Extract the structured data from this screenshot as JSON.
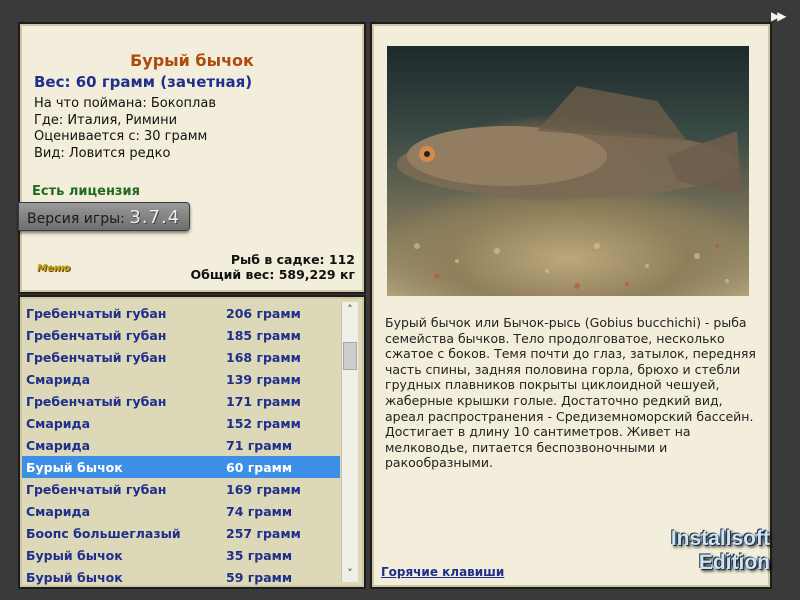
{
  "fish": {
    "title": "Бурый бычок",
    "weight": "Вес: 60 грамм (зачетная)",
    "bait": "На что поймана: Бокоплав",
    "place": "Где: Италия, Римини",
    "rated_from": "Оценивается с: 30 грамм",
    "kind": "Вид: Ловится редко"
  },
  "license": "Есть лицензия",
  "version": {
    "label": "Версия игры:",
    "number": "3.7.4"
  },
  "menu_logo": "Меню",
  "stats": {
    "fish_in_keepnet": "Рыб в садке: 112",
    "total_weight": "Общий вес: 589,229 кг"
  },
  "catch_list": [
    {
      "name": "Гребенчатый губан",
      "weight": "206 грамм"
    },
    {
      "name": "Гребенчатый губан",
      "weight": "185 грамм"
    },
    {
      "name": "Гребенчатый губан",
      "weight": "168 грамм"
    },
    {
      "name": "Смарида",
      "weight": "139 грамм"
    },
    {
      "name": "Гребенчатый губан",
      "weight": "171 грамм"
    },
    {
      "name": "Смарида",
      "weight": "152 грамм"
    },
    {
      "name": "Смарида",
      "weight": "71 грамм"
    },
    {
      "name": "Бурый бычок",
      "weight": "60 грамм"
    },
    {
      "name": "Гребенчатый губан",
      "weight": "169 грамм"
    },
    {
      "name": "Смарида",
      "weight": "74 грамм"
    },
    {
      "name": "Боопс большеглазый",
      "weight": "257 грамм"
    },
    {
      "name": "Бурый бычок",
      "weight": "35 грамм"
    },
    {
      "name": "Бурый бычок",
      "weight": "59 грамм"
    }
  ],
  "selected_index": 7,
  "description": "Бурый бычок или Бычок-рысь (Gobius bucchichi) - рыба семейства бычков. Тело продолговатое, несколько сжатое с боков. Темя почти до глаз, затылок, передняя часть спины, задняя половина горла, брюхо и стебли грудных плавников покрыты циклоидной чешуей, жаберные крышки голые. Достаточно редкий вид, ареал распространения - Средиземноморский бассейн. Достигает в длину 10 сантиметров. Живет на мелководье, питается беспозвоночными и ракообразными.",
  "hotkeys_link": "Горячие клавиши",
  "watermark": {
    "line1": "Installsoft",
    "line2": "Edition"
  },
  "icons": {
    "forward": "fast-forward-icon",
    "scroll_up": "chevron-up-icon",
    "scroll_down": "chevron-down-icon"
  },
  "colors": {
    "title": "#b04a0c",
    "accent_blue": "#1f2f8c",
    "selection": "#3d8ee6",
    "license_green": "#1e6b1e"
  }
}
